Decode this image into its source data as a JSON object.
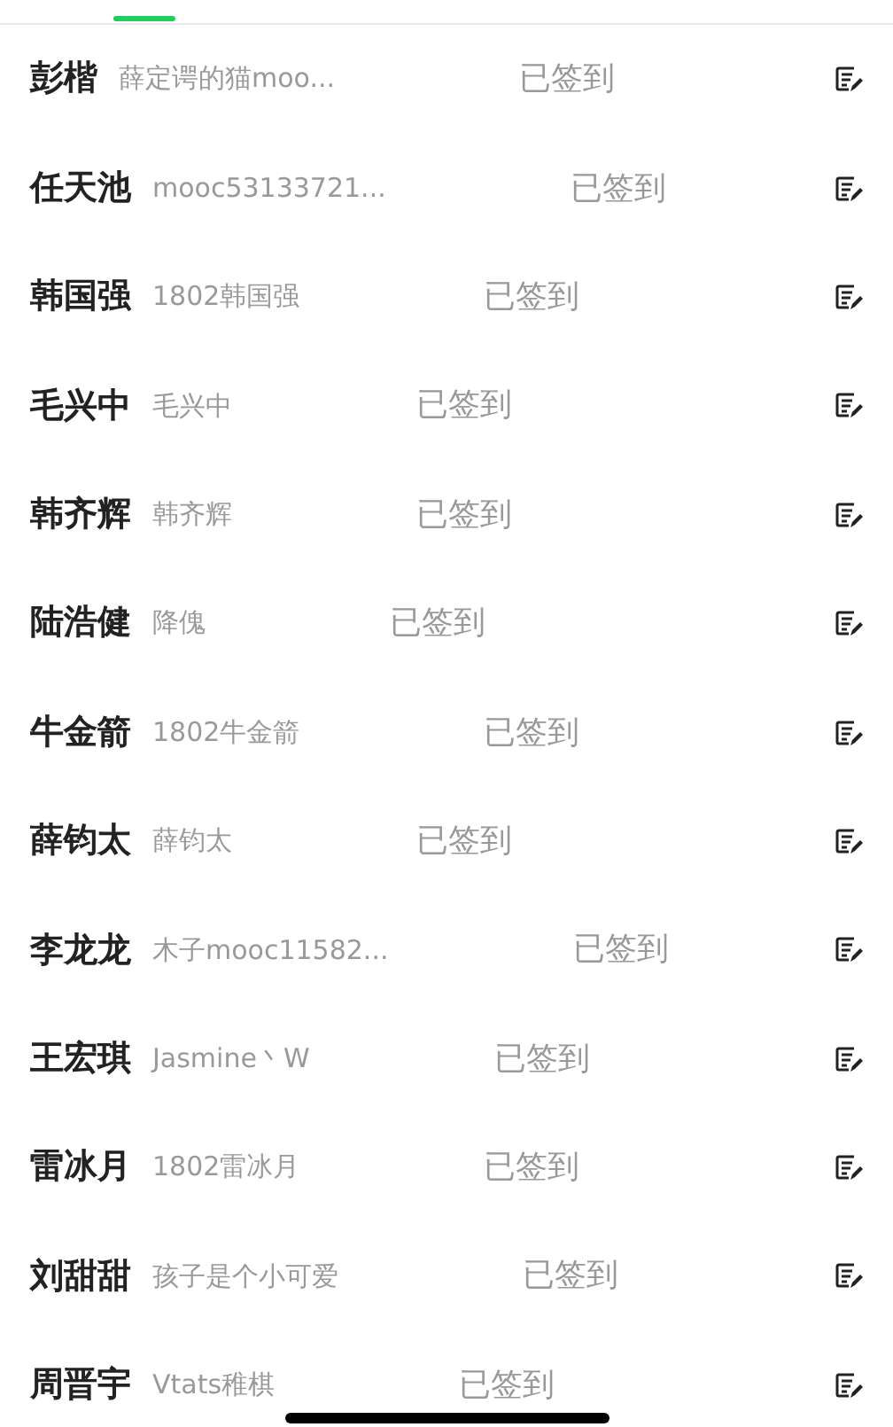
{
  "students": [
    {
      "name": "彭楷",
      "nickname": "薛定谔的猫moo...",
      "status": "已签到"
    },
    {
      "name": "任天池",
      "nickname": "mooc53133721...",
      "status": "已签到"
    },
    {
      "name": "韩国强",
      "nickname": "1802韩国强",
      "status": "已签到"
    },
    {
      "name": "毛兴中",
      "nickname": "毛兴中",
      "status": "已签到"
    },
    {
      "name": "韩齐辉",
      "nickname": "韩齐辉",
      "status": "已签到"
    },
    {
      "name": "陆浩健",
      "nickname": "降傀",
      "status": "已签到"
    },
    {
      "name": "牛金箭",
      "nickname": "1802牛金箭",
      "status": "已签到"
    },
    {
      "name": "薛钧太",
      "nickname": "薛钧太",
      "status": "已签到"
    },
    {
      "name": "李龙龙",
      "nickname": "木子mooc11582...",
      "status": "已签到"
    },
    {
      "name": "王宏琪",
      "nickname": "Jasmine丶W",
      "status": "已签到"
    },
    {
      "name": "雷冰月",
      "nickname": "1802雷冰月",
      "status": "已签到"
    },
    {
      "name": "刘甜甜",
      "nickname": "孩子是个小可爱",
      "status": "已签到"
    },
    {
      "name": "周晋宇",
      "nickname": "Vtats稚棋",
      "status": "已签到"
    }
  ]
}
